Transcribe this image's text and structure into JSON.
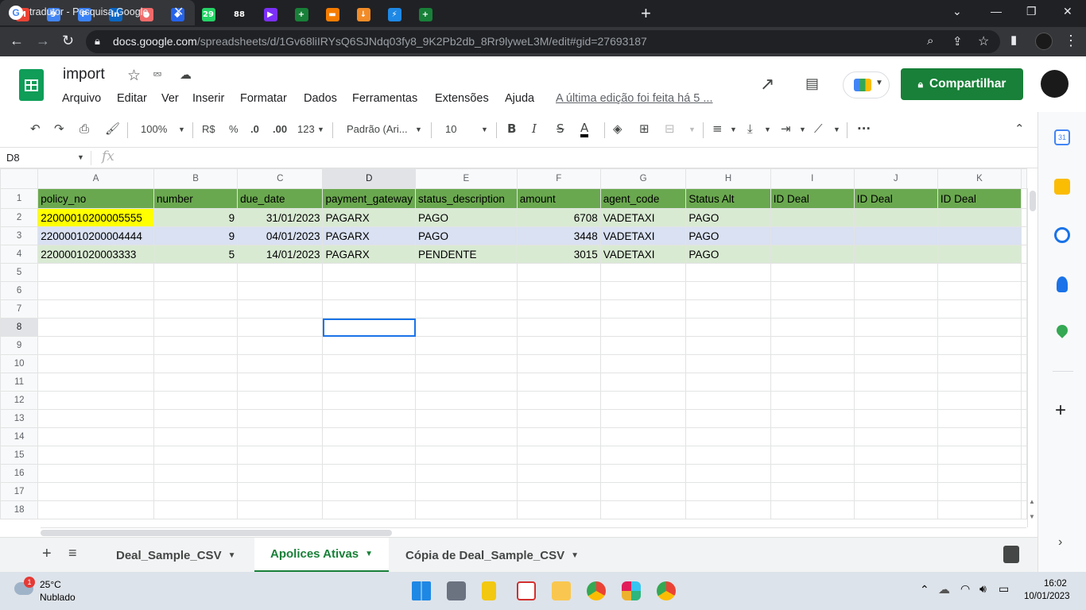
{
  "browser": {
    "active_tab_title": "tradutor - Pesquisa Google",
    "pinned_tabs": [
      {
        "icon": "gmail-icon",
        "label": "M",
        "color": "#ea4335"
      },
      {
        "icon": "calendar-icon",
        "label": "9",
        "color": "#4285f4"
      },
      {
        "icon": "pipefy-icon",
        "label": "P",
        "color": "#3b82f6"
      },
      {
        "icon": "linkedin-icon",
        "label": "in",
        "color": "#0a66c2"
      },
      {
        "icon": "asana-icon",
        "label": "●",
        "color": "#f06a6a"
      },
      {
        "icon": "jira-icon",
        "label": "◆",
        "color": "#2563eb"
      },
      {
        "icon": "whatsapp-icon",
        "label": "29",
        "color": "#25d366"
      },
      {
        "icon": "notification-icon",
        "label": "88",
        "color": "#202124"
      },
      {
        "icon": "clickup-icon",
        "label": "▶",
        "color": "#7b2ff7"
      },
      {
        "icon": "sheets-icon",
        "label": "+",
        "color": "#188038"
      },
      {
        "icon": "orange-app-icon",
        "label": "▬",
        "color": "#f57c00"
      },
      {
        "icon": "download-app-icon",
        "label": "↓",
        "color": "#f28c28"
      },
      {
        "icon": "bolt-app-icon",
        "label": "⚡",
        "color": "#1e88e5"
      },
      {
        "icon": "sheets-icon",
        "label": "+",
        "color": "#188038"
      }
    ],
    "url_host": "docs.google.com",
    "url_path": "/spreadsheets/d/1Gv68liIRYsQ6SJNdq03fy8_9K2Pb2db_8Rr9lyweL3M/edit#gid=27693187"
  },
  "doc": {
    "title": "import",
    "menu": [
      "Arquivo",
      "Editar",
      "Ver",
      "Inserir",
      "Formatar",
      "Dados",
      "Ferramentas",
      "Extensões",
      "Ajuda"
    ],
    "last_edit": "A última edição foi feita há 5 ...",
    "share_label": "Compartilhar"
  },
  "toolbar": {
    "zoom": "100%",
    "currency": "R$",
    "percent": "%",
    "dec_decrease": ".0",
    "dec_increase": ".00",
    "format_more": "123",
    "font": "Padrão (Ari...",
    "font_size": "10",
    "bold": "B",
    "italic": "I",
    "strike": "S",
    "text_color": "A",
    "more": "···"
  },
  "formula_bar": {
    "name_box": "D8",
    "fx": "fx"
  },
  "grid": {
    "columns": [
      "A",
      "B",
      "C",
      "D",
      "E",
      "F",
      "G",
      "H",
      "I",
      "J",
      "K"
    ],
    "header_row": [
      "policy_no",
      "number",
      "due_date",
      "payment_gateway",
      "status_description",
      "amount",
      "agent_code",
      "Status Alt",
      "ID Deal",
      "ID Deal",
      "ID Deal"
    ],
    "rows": [
      [
        "22000010200005555",
        "9",
        "31/01/2023",
        "PAGARX",
        "PAGO",
        "6708",
        "VADETAXI",
        "PAGO",
        "",
        "",
        ""
      ],
      [
        "22000010200004444",
        "9",
        "04/01/2023",
        "PAGARX",
        "PAGO",
        "3448",
        "VADETAXI",
        "PAGO",
        "",
        "",
        ""
      ],
      [
        "2200001020003333",
        "5",
        "14/01/2023",
        "PAGARX",
        "PENDENTE",
        "3015",
        "VADETAXI",
        "PAGO",
        "",
        "",
        ""
      ]
    ],
    "row_numbers": [
      "1",
      "2",
      "3",
      "4",
      "5",
      "6",
      "7",
      "8",
      "9",
      "10",
      "11",
      "12",
      "13",
      "14",
      "15",
      "16",
      "17",
      "18"
    ],
    "selected_cell": "D8"
  },
  "sheets": {
    "tabs": [
      "Deal_Sample_CSV",
      "Apolices Ativas",
      "Cópia de Deal_Sample_CSV"
    ],
    "active": "Apolices Ativas"
  },
  "taskbar": {
    "weather_temp": "25°C",
    "weather_desc": "Nublado",
    "weather_badge": "1",
    "time": "16:02",
    "date": "10/01/2023"
  }
}
